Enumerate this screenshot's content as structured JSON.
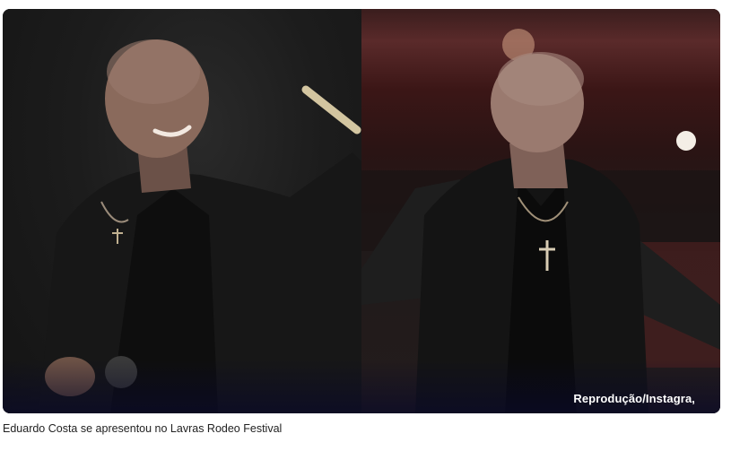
{
  "figure": {
    "credit": "Reprodução/Instagra,",
    "caption": "Eduardo Costa se apresentou no Lavras Rodeo Festival"
  },
  "photos": {
    "left": {
      "subject": "singer-on-stage-left"
    },
    "right": {
      "subject": "singer-on-stage-right"
    }
  }
}
